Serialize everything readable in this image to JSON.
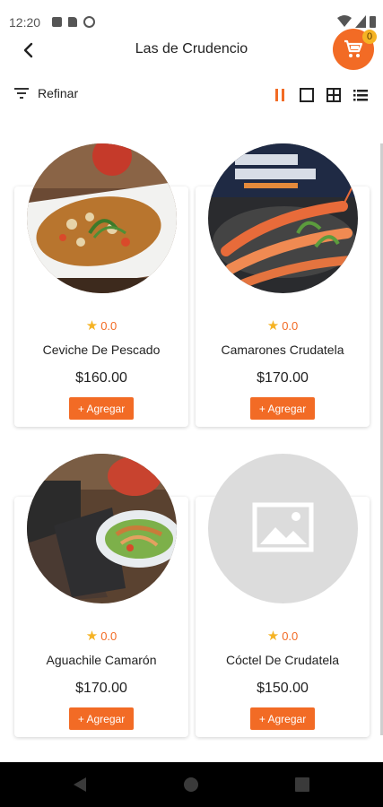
{
  "status_bar": {
    "time": "12:20"
  },
  "header": {
    "title": "Las de Crudencio",
    "cart_count": "0"
  },
  "toolbar": {
    "refine_label": "Refinar"
  },
  "products": [
    {
      "name": "Ceviche De Pescado",
      "rating": "0.0",
      "price": "$160.00",
      "add_label": "+ Agregar",
      "image": "ceviche-photo"
    },
    {
      "name": "Camarones Crudatela",
      "rating": "0.0",
      "price": "$170.00",
      "add_label": "+ Agregar",
      "image": "shrimp-photo"
    },
    {
      "name": "Aguachile Camarón",
      "rating": "0.0",
      "price": "$170.00",
      "add_label": "+ Agregar",
      "image": "aguachile-photo"
    },
    {
      "name": "Cóctel De Crudatela",
      "rating": "0.0",
      "price": "$150.00",
      "add_label": "+ Agregar",
      "image": "image-placeholder-icon"
    }
  ],
  "colors": {
    "accent": "#f26b25",
    "badge": "#f5b324",
    "star": "#f5b324",
    "placeholder": "#dcdcdc"
  }
}
